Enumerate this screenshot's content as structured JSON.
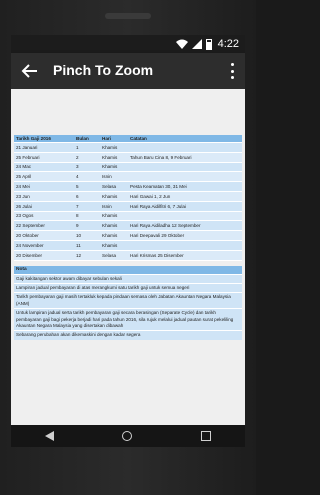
{
  "status_bar": {
    "time": "4:22"
  },
  "app_bar": {
    "title": "Pinch To Zoom"
  },
  "gaji_table": {
    "headers": [
      "Tarikh Gaji 2016",
      "Bulan",
      "Hari",
      "Catatan"
    ],
    "rows": [
      [
        "21 Januari",
        "1",
        "Khamis",
        ""
      ],
      [
        "25 Februari",
        "2",
        "Khamis",
        "Tahun Baru Cina 8, 9 Februari"
      ],
      [
        "24 Mac",
        "3",
        "Khamis",
        ""
      ],
      [
        "25 April",
        "4",
        "Isnin",
        ""
      ],
      [
        "24 Mei",
        "5",
        "Selasa",
        "Pesta Keamatan 30, 31 Mei"
      ],
      [
        "23 Jun",
        "6",
        "Khamis",
        "Hari Gawai 1, 2 Jun"
      ],
      [
        "26 Julai",
        "7",
        "Isnin",
        "Hari Raya Aidilfitri 6, 7 Julai"
      ],
      [
        "23 Ogos",
        "8",
        "Khamis",
        ""
      ],
      [
        "22 September",
        "9",
        "Khamis",
        "Hari Raya Aidiladha 12 September"
      ],
      [
        "20 Oktober",
        "10",
        "Khamis",
        "Hari Deepavali 29 Oktober"
      ],
      [
        "24 November",
        "11",
        "Khamis",
        ""
      ],
      [
        "20 Disember",
        "12",
        "Selasa",
        "Hari Krismas 25 Disember"
      ]
    ]
  },
  "notes": {
    "title": "Nota",
    "items": [
      "Gaji kakitangan sektor awam dibayar sebulan sekali",
      "Lampiran jadual pembayaran di atas merangkumi satu tarikh gaji untuk semua negeri",
      "Tarikh pembayaran gaji masih tertakluk kepada pindaan semasa oleh Jabatan Akauntan Negara Malaysia (ANM)",
      "Untuk lampiran jadual serta tarikh pembayaran gaji secara berasingan (Separate Cycle) dan tarikh pembayaran gaji bagi pekerja berjadi hari pada tahun 2016, sila rujuk melalui jadual pautan surat pekeliling Akauntan Negara Malaysia yang disertakan dibawah",
      "Sebarang perubahan akan dikemaskini dengan kadar segera"
    ]
  }
}
